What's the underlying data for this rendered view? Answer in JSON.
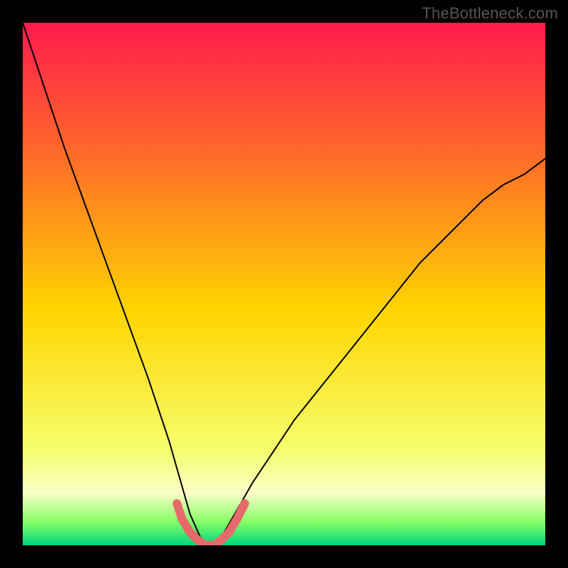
{
  "watermark": "TheBottleneck.com",
  "chart_data": {
    "type": "line",
    "title": "",
    "xlabel": "",
    "ylabel": "",
    "xlim": [
      0,
      100
    ],
    "ylim": [
      0,
      100
    ],
    "grid": false,
    "legend": false,
    "background_gradient": {
      "top": "#ff1a4d",
      "mid_upper": "#ff6a2a",
      "mid": "#ffd400",
      "mid_lower": "#f6ff6e",
      "lower_band_top": "#f9ffc8",
      "near_bottom": "#86ff66",
      "bottom": "#00d47d"
    },
    "series": [
      {
        "name": "bottleneck-curve",
        "color": "#000000",
        "stroke_width": 2,
        "x": [
          0,
          4,
          8,
          12,
          16,
          20,
          24,
          28,
          30,
          32,
          34,
          36,
          38,
          40,
          44,
          48,
          52,
          56,
          60,
          64,
          68,
          72,
          76,
          80,
          84,
          88,
          92,
          96,
          100
        ],
        "y": [
          100,
          88,
          76,
          65,
          54,
          43,
          32,
          20,
          13,
          6,
          1.5,
          0,
          1.5,
          5,
          12,
          18,
          24,
          29,
          34,
          39,
          44,
          49,
          54,
          58,
          62,
          66,
          69,
          71,
          74
        ]
      },
      {
        "name": "valley-highlight",
        "color": "#e76a6a",
        "stroke_width": 12,
        "cap": "round",
        "x": [
          29.5,
          30.5,
          32,
          33.5,
          35,
          36.5,
          38,
          39.5,
          41,
          42.5
        ],
        "y": [
          8,
          5,
          2.5,
          1,
          0,
          0,
          1,
          2.5,
          5,
          8
        ]
      }
    ],
    "annotations": []
  }
}
